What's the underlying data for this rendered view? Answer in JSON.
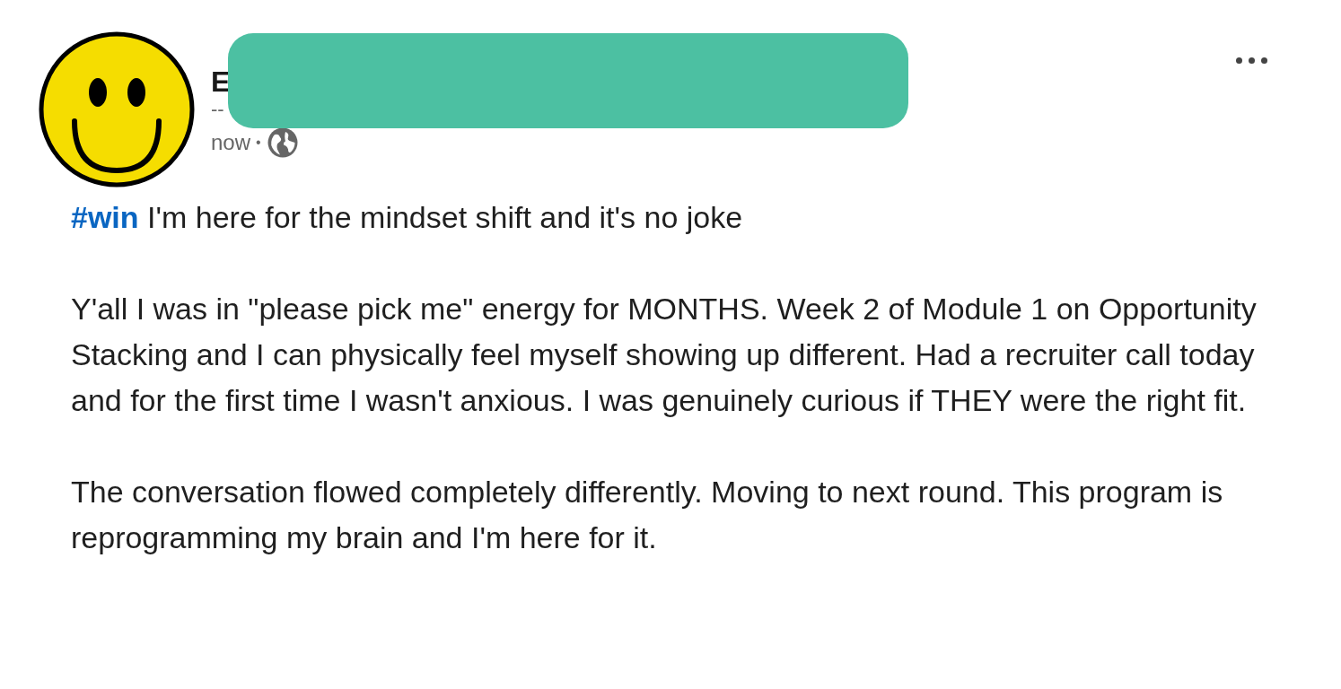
{
  "post": {
    "author_name": "E",
    "headline": "--",
    "timestamp": "now",
    "separator": "•",
    "hashtag": "#win",
    "first_line": "I'm here for the mindset shift and it's no joke",
    "paragraphs": [
      "Y'all I was in \"please pick me\" energy for MONTHS. Week 2 of Module 1 on Opportunity Stacking and I can physically feel myself showing up different. Had a recruiter call today and for the first time I wasn't anxious. I was genuinely curious if THEY were the right fit.",
      "The conversation flowed completely differently. Moving to next round. This program is reprogramming my brain and I'm here for it."
    ]
  }
}
